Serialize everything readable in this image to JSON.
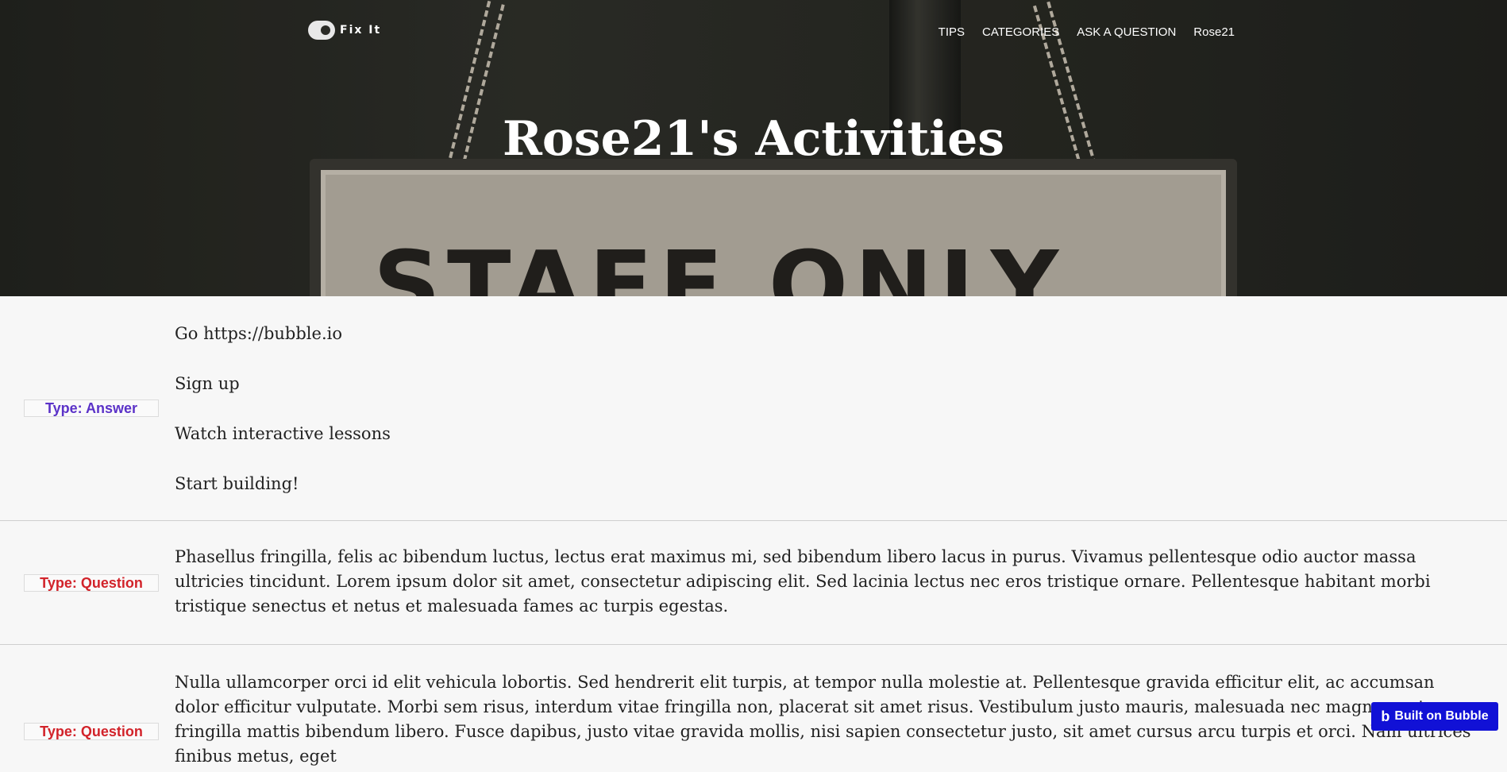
{
  "header": {
    "logo_text": "Fix It",
    "nav": [
      "TIPS",
      "CATEGORIES",
      "ASK A QUESTION",
      "Rose21"
    ],
    "title": "Rose21's Activities",
    "hero_sign_text": "STAFF ONLY"
  },
  "activities": [
    {
      "type": "Type: Answer",
      "lines": [
        "Go https://bubble.io",
        "Sign up",
        "Watch interactive lessons",
        "Start building!"
      ]
    },
    {
      "type": "Type: Question",
      "text": "Phasellus fringilla, felis ac bibendum luctus, lectus erat maximus mi, sed bibendum libero lacus in purus. Vivamus pellentesque odio auctor massa ultricies tincidunt. Lorem ipsum dolor sit amet, consectetur adipiscing elit. Sed lacinia lectus nec eros tristique ornare. Pellentesque habitant morbi tristique senectus et netus et malesuada fames ac turpis egestas."
    },
    {
      "type": "Type: Question",
      "text": "Nulla ullamcorper orci id elit vehicula lobortis. Sed hendrerit elit turpis, at tempor nulla molestie at. Pellentesque gravida efficitur elit, ac accumsan dolor efficitur vulputate. Morbi sem risus, interdum vitae fringilla non, placerat sit amet risus. Vestibulum justo mauris, malesuada nec magna eget, fringilla mattis bibendum libero. Fusce dapibus, justo vitae gravida mollis, nisi sapien consectetur justo, sit amet cursus arcu turpis et orci. Nam ultrices finibus metus, eget"
    }
  ],
  "footer_badge": {
    "icon": "b",
    "label": "Built on Bubble"
  },
  "colors": {
    "answer": "#5b32c8",
    "question": "#d2232a",
    "bubble": "#1111d6"
  }
}
